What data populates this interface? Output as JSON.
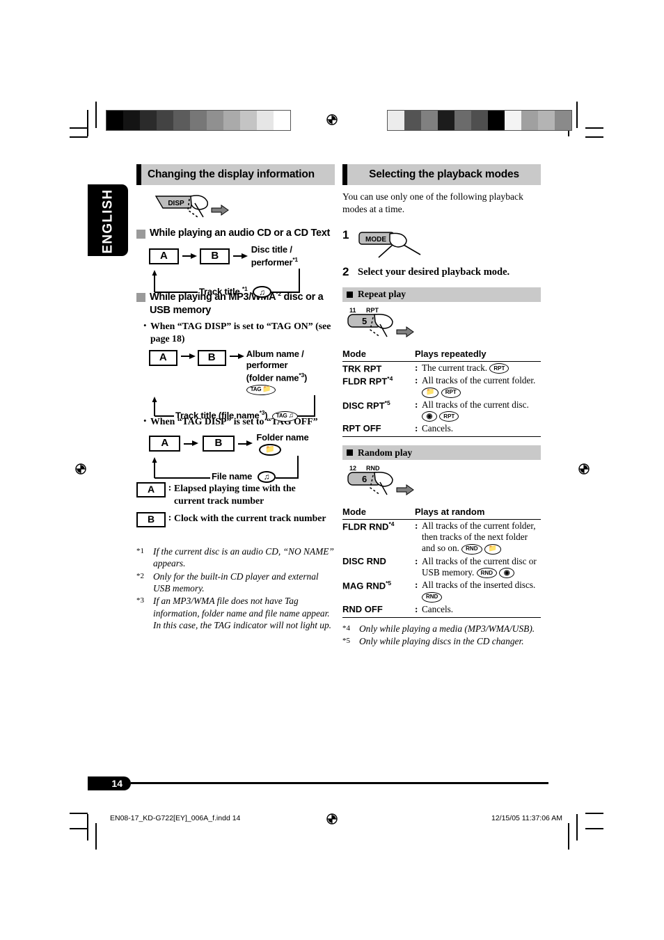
{
  "page": {
    "language_tab": "ENGLISH",
    "page_number": "14",
    "print_file": "EN08-17_KD-G722[EY]_006A_f.indd   14",
    "print_date": "12/15/05   11:37:06 AM"
  },
  "left": {
    "section_title": "Changing the display information",
    "disp_button": "DISP",
    "sub1_title": "While playing an audio CD or a CD Text",
    "flow1": {
      "box_a": "A",
      "box_b": "B",
      "item1": "Disc title / performer",
      "item1_sup": "*1",
      "item2": "Track title ",
      "item2_sup": "*1",
      "item2_icon": "music-note-indicator"
    },
    "sub2_title_part1": "While playing an MP3/WMA",
    "sub2_sup": "*2",
    "sub2_title_part2": " disc or a USB memory",
    "bullet_tag_on": "When “TAG DISP” is set to “TAG ON” (see page 18)",
    "flow2": {
      "box_a": "A",
      "box_b": "B",
      "item1_line1": "Album name / performer",
      "item1_line2": "(folder name",
      "item1_sup": "*3",
      "item1_close": ")",
      "item1_pill": "TAG",
      "item1_pill_glyph": "folder",
      "item2": "Track title (file name",
      "item2_sup": "*3",
      "item2_close": ")",
      "item2_pill": "TAG",
      "item2_pill_glyph": "music-note"
    },
    "bullet_tag_off": "When “TAG DISP” is set to “TAG OFF”",
    "flow3": {
      "box_a": "A",
      "box_b": "B",
      "item1": "Folder name",
      "item1_icon": "folder-indicator",
      "item2": "File name",
      "item2_icon": "music-note-indicator"
    },
    "legend": [
      {
        "box": "A",
        "colon": ":",
        "text": "Elapsed playing time with the current track number"
      },
      {
        "box": "B",
        "colon": ":",
        "text": "Clock with the current track number"
      }
    ],
    "footnotes": [
      {
        "marker": "*1",
        "text": "If the current disc is an audio CD, “NO NAME” appears."
      },
      {
        "marker": "*2",
        "text": "Only for the built-in CD player and external USB memory."
      },
      {
        "marker": "*3",
        "text": "If an MP3/WMA file does not have Tag information, folder name and file name appear. In this case, the TAG indicator will not light up."
      }
    ]
  },
  "right": {
    "section_title": "Selecting the playback modes",
    "intro": "You can use only one of the following playback modes at a time.",
    "step1_num": "1",
    "step1_button": "MODE",
    "step2_num": "2",
    "step2_text": "Select your desired playback mode.",
    "repeat": {
      "title": "Repeat play",
      "key_top_num": "11",
      "key_top_label": "RPT",
      "key_face": "5",
      "col_mode": "Mode",
      "col_desc": "Plays repeatedly",
      "rows": [
        {
          "mode": "TRK RPT",
          "sup": "",
          "colon": ":",
          "desc": "The current track.",
          "pills": [
            "RPT"
          ]
        },
        {
          "mode": "FLDR RPT",
          "sup": "*4",
          "colon": ":",
          "desc": "All tracks of the current folder.",
          "pills": [
            "folder",
            "RPT"
          ]
        },
        {
          "mode": "DISC RPT",
          "sup": "*5",
          "colon": ":",
          "desc": "All tracks of the current disc.",
          "pills": [
            "disc",
            "RPT"
          ]
        },
        {
          "mode": "RPT OFF",
          "sup": "",
          "colon": ":",
          "desc": "Cancels.",
          "pills": []
        }
      ]
    },
    "random": {
      "title": "Random play",
      "key_top_num": "12",
      "key_top_label": "RND",
      "key_face": "6",
      "col_mode": "Mode",
      "col_desc": "Plays at random",
      "rows": [
        {
          "mode": "FLDR RND",
          "sup": "*4",
          "colon": ":",
          "desc": "All tracks of the current folder, then tracks of the next folder and so on.",
          "pills": [
            "RND",
            "folder"
          ]
        },
        {
          "mode": "DISC RND",
          "sup": "",
          "colon": ":",
          "desc": "All tracks of the current disc or USB memory.",
          "pills": [
            "RND",
            "disc"
          ]
        },
        {
          "mode": "MAG RND",
          "sup": "*5",
          "colon": ":",
          "desc": "All tracks of the inserted discs.",
          "pills": [
            "RND"
          ]
        },
        {
          "mode": "RND OFF",
          "sup": "",
          "colon": ":",
          "desc": "Cancels.",
          "pills": []
        }
      ]
    },
    "footnotes": [
      {
        "marker": "*4",
        "text": "Only while playing a media (MP3/WMA/USB)."
      },
      {
        "marker": "*5",
        "text": "Only while playing discs in the CD changer."
      }
    ]
  },
  "calibration": {
    "left_strip": [
      "#000000",
      "#141414",
      "#2b2b2b",
      "#434343",
      "#5c5c5c",
      "#777777",
      "#909090",
      "#aaaaaa",
      "#c4c4c4",
      "#e6e6e6",
      "#ffffff"
    ],
    "right_strip": [
      "#ececec",
      "#545454",
      "#808080",
      "#1c1c1c",
      "#6b6b6b",
      "#4f4f4f",
      "#000000",
      "#f4f4f4",
      "#a0a0a0",
      "#b4b4b4",
      "#8a8a8a"
    ]
  }
}
